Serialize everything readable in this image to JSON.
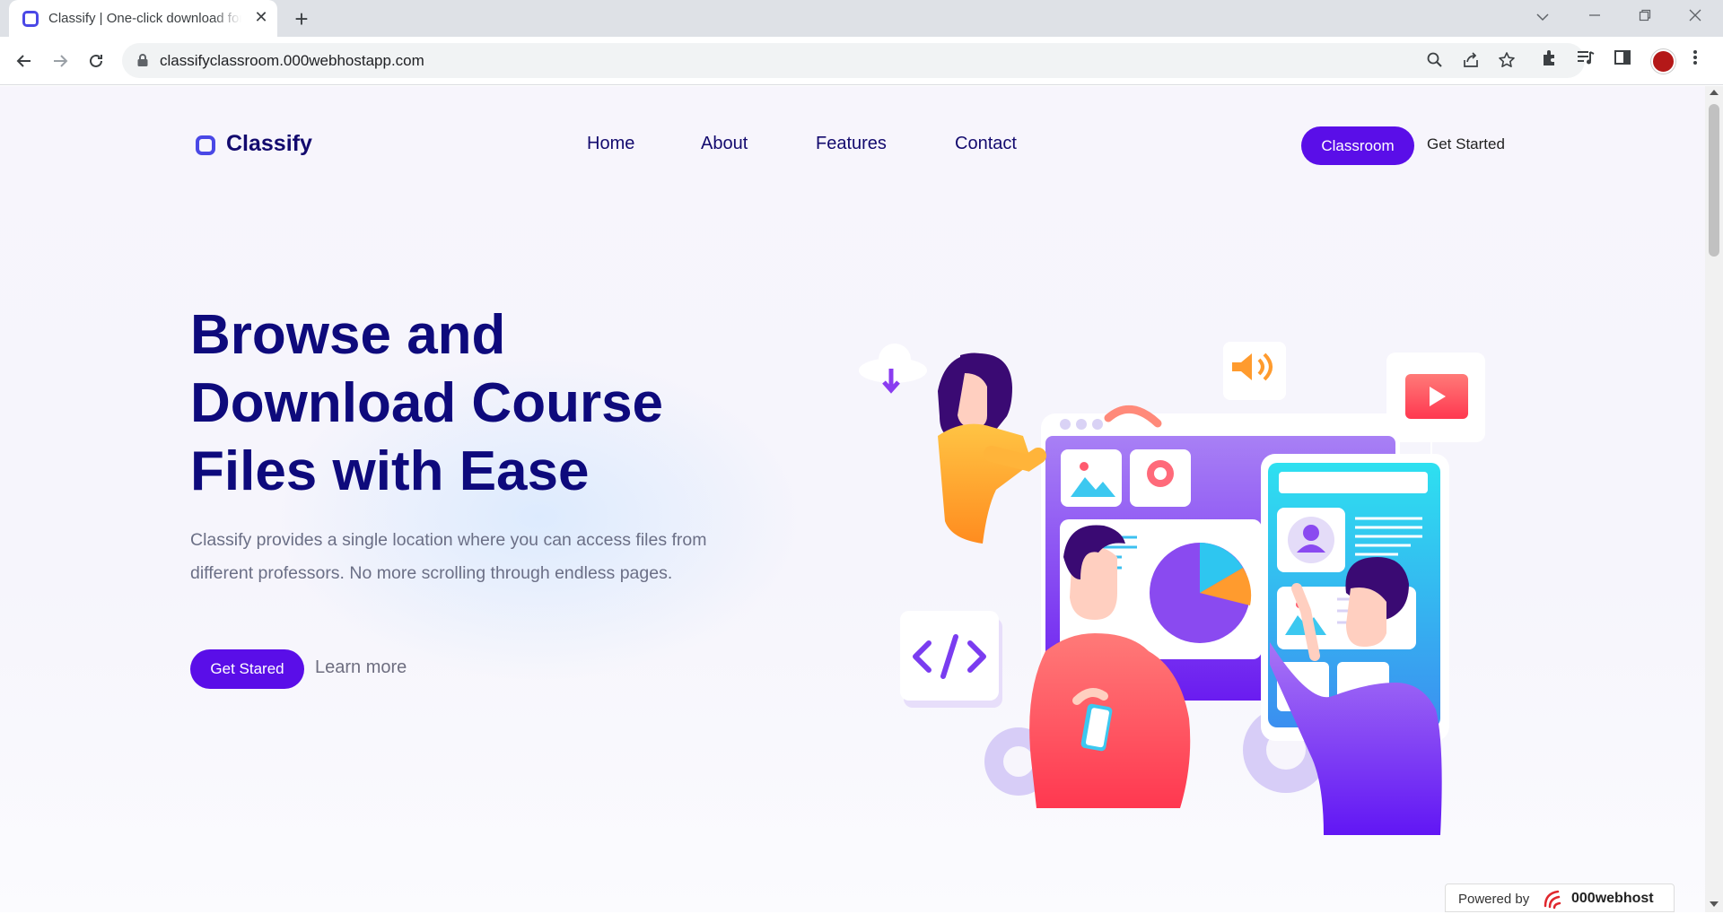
{
  "browser": {
    "tab_title": "Classify | One-click download for",
    "url": "classifyclassroom.000webhostapp.com"
  },
  "site": {
    "logo": "Classify",
    "nav": [
      "Home",
      "About",
      "Features",
      "Contact"
    ],
    "classroom_button": "Classroom",
    "get_started_link": "Get Started"
  },
  "hero": {
    "title": "Browse and Download Course Files with Ease",
    "description": "Classify provides a single location where you can access files from different professors. No more scrolling through endless pages.",
    "primary_button": "Get Stared",
    "secondary_link": "Learn more"
  },
  "footer_badge": {
    "label": "Powered by",
    "brand": "000webhost"
  },
  "colors": {
    "accent": "#5a0ee8",
    "heading": "#0e0a7c",
    "logo": "#4a48e6"
  },
  "icons": [
    "back-arrow-icon",
    "forward-arrow-icon",
    "reload-icon",
    "lock-icon",
    "search-icon",
    "share-icon",
    "star-icon",
    "extensions-icon",
    "media-icon",
    "side-panel-icon",
    "menu-icon"
  ]
}
